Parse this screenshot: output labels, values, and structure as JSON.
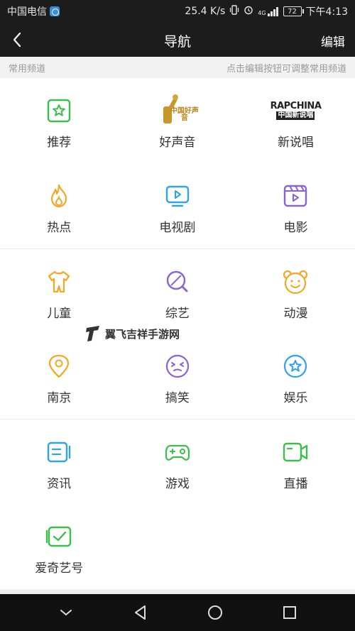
{
  "status_bar": {
    "carrier": "中国电信",
    "speed": "25.4 K/s",
    "network": "4G",
    "battery": "72",
    "time": "下午4:13"
  },
  "nav": {
    "title": "导航",
    "edit_label": "编辑"
  },
  "section": {
    "title": "常用频道",
    "hint": "点击编辑按钮可调整常用频道"
  },
  "channels": [
    {
      "label": "推荐",
      "icon": "star-icon",
      "color": "#3cbf4a"
    },
    {
      "label": "好声音",
      "icon": "good-voice-logo",
      "logo_text": "中国好声音"
    },
    {
      "label": "新说唱",
      "icon": "rap-china-logo",
      "logo_text": "RAPCHINA",
      "logo_sub": "中国新说唱"
    },
    {
      "label": "热点",
      "icon": "flame-icon",
      "color": "#f5a623"
    },
    {
      "label": "电视剧",
      "icon": "tv-icon",
      "color": "#2fa3e6"
    },
    {
      "label": "电影",
      "icon": "film-icon",
      "color": "#8a63d2"
    },
    {
      "label": "儿童",
      "icon": "baby-clothes-icon",
      "color": "#f5a623"
    },
    {
      "label": "综艺",
      "icon": "magnifier-icon",
      "color": "#8a63d2"
    },
    {
      "label": "动漫",
      "icon": "bear-face-icon",
      "color": "#f5a623"
    },
    {
      "label": "南京",
      "icon": "location-pin-icon",
      "color": "#f5a623"
    },
    {
      "label": "搞笑",
      "icon": "funny-face-icon",
      "color": "#8a63d2"
    },
    {
      "label": "娱乐",
      "icon": "star-circle-icon",
      "color": "#2fa3e6"
    },
    {
      "label": "资讯",
      "icon": "news-icon",
      "color": "#2fa3e6"
    },
    {
      "label": "游戏",
      "icon": "gamepad-icon",
      "color": "#3cbf4a"
    },
    {
      "label": "直播",
      "icon": "live-camera-icon",
      "color": "#3cbf4a"
    },
    {
      "label": "爱奇艺号",
      "icon": "check-box-icon",
      "color": "#3cbf4a"
    }
  ],
  "watermark": "翼飞吉祥手游网",
  "colors": {
    "bar_bg": "#1c1c1c",
    "green": "#3cbf4a",
    "orange": "#f5a623",
    "blue": "#2fa3e6",
    "purple": "#8a63d2"
  }
}
